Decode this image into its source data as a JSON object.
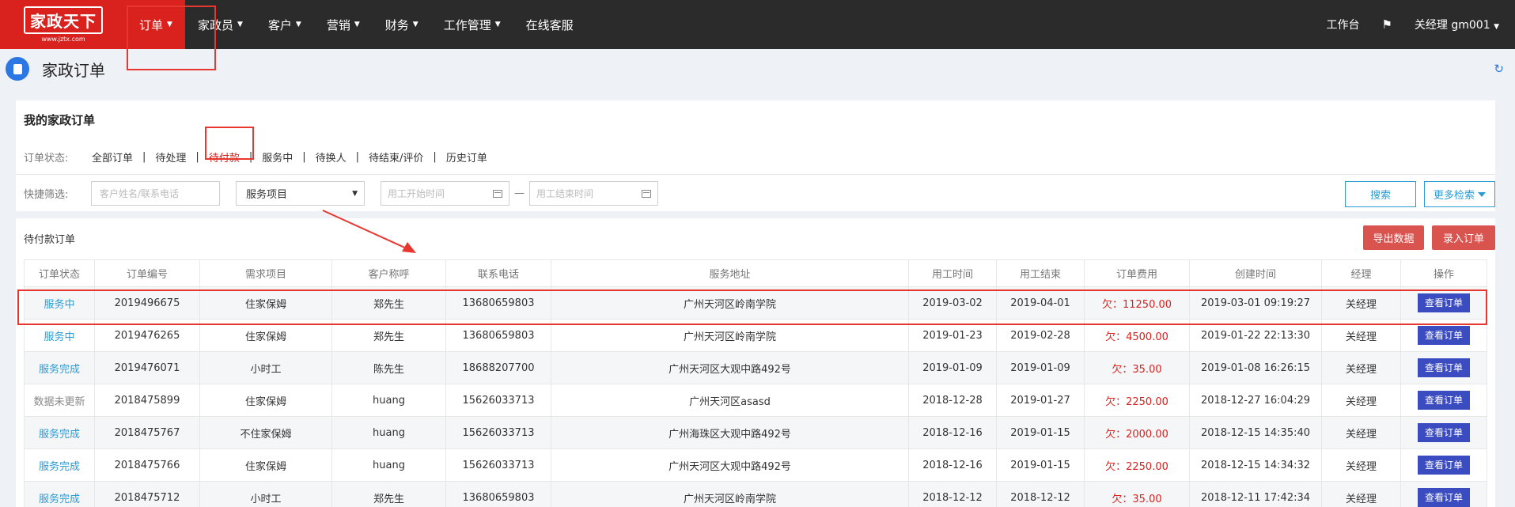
{
  "logo": {
    "main": "家政天下",
    "sub": "www.jztx.com"
  },
  "nav": {
    "items": [
      {
        "label": "订单",
        "active": true
      },
      {
        "label": "家政员",
        "active": false
      },
      {
        "label": "客户",
        "active": false
      },
      {
        "label": "营销",
        "active": false
      },
      {
        "label": "财务",
        "active": false
      },
      {
        "label": "工作管理",
        "active": false
      },
      {
        "label": "在线客服",
        "active": false
      }
    ],
    "workbench": "工作台",
    "user": "关经理 gm001"
  },
  "page": {
    "title": "家政订单"
  },
  "filter": {
    "title": "我的家政订单",
    "status_label": "订单状态:",
    "tabs": [
      "全部订单",
      "待处理",
      "待付款",
      "服务中",
      "待换人",
      "待结束/评价",
      "历史订单"
    ],
    "active_tab": "待付款",
    "quick_label": "快捷筛选:",
    "customer_placeholder": "客户姓名/联系电话",
    "service_select": "服务项目",
    "start_placeholder": "用工开始时间",
    "end_placeholder": "用工结束时间",
    "search_btn": "搜索",
    "more_btn": "更多检索"
  },
  "orders": {
    "title": "待付款订单",
    "export_btn": "导出数据",
    "add_btn": "录入订单",
    "columns": [
      "订单状态",
      "订单编号",
      "需求项目",
      "客户称呼",
      "联系电话",
      "服务地址",
      "用工时间",
      "用工结束",
      "订单费用",
      "创建时间",
      "经理",
      "操作"
    ],
    "view_btn": "查看订单",
    "rows": [
      {
        "status": "服务中",
        "status_type": "blue",
        "id": "2019496675",
        "item": "住家保姆",
        "customer": "郑先生",
        "phone": "13680659803",
        "address": "广州天河区岭南学院",
        "start": "2019-03-02",
        "end": "2019-04-01",
        "fee": "欠：11250.00",
        "created": "2019-03-01 09:19:27",
        "manager": "关经理"
      },
      {
        "status": "服务中",
        "status_type": "blue",
        "id": "2019476265",
        "item": "住家保姆",
        "customer": "郑先生",
        "phone": "13680659803",
        "address": "广州天河区岭南学院",
        "start": "2019-01-23",
        "end": "2019-02-28",
        "fee": "欠：4500.00",
        "created": "2019-01-22 22:13:30",
        "manager": "关经理"
      },
      {
        "status": "服务完成",
        "status_type": "blue",
        "id": "2019476071",
        "item": "小时工",
        "customer": "陈先生",
        "phone": "18688207700",
        "address": "广州天河区大观中路492号",
        "start": "2019-01-09",
        "end": "2019-01-09",
        "fee": "欠：35.00",
        "created": "2019-01-08 16:26:15",
        "manager": "关经理"
      },
      {
        "status": "数据未更新",
        "status_type": "gray",
        "id": "2018475899",
        "item": "住家保姆",
        "customer": "huang",
        "phone": "15626033713",
        "address": "广州天河区asasd",
        "start": "2018-12-28",
        "end": "2019-01-27",
        "fee": "欠：2250.00",
        "created": "2018-12-27 16:04:29",
        "manager": "关经理"
      },
      {
        "status": "服务完成",
        "status_type": "blue",
        "id": "2018475767",
        "item": "不住家保姆",
        "customer": "huang",
        "phone": "15626033713",
        "address": "广州海珠区大观中路492号",
        "start": "2018-12-16",
        "end": "2019-01-15",
        "fee": "欠：2000.00",
        "created": "2018-12-15 14:35:40",
        "manager": "关经理"
      },
      {
        "status": "服务完成",
        "status_type": "blue",
        "id": "2018475766",
        "item": "住家保姆",
        "customer": "huang",
        "phone": "15626033713",
        "address": "广州天河区大观中路492号",
        "start": "2018-12-16",
        "end": "2019-01-15",
        "fee": "欠：2250.00",
        "created": "2018-12-15 14:34:32",
        "manager": "关经理"
      },
      {
        "status": "服务完成",
        "status_type": "blue",
        "id": "2018475712",
        "item": "小时工",
        "customer": "郑先生",
        "phone": "13680659803",
        "address": "广州天河区岭南学院",
        "start": "2018-12-12",
        "end": "2018-12-12",
        "fee": "欠：35.00",
        "created": "2018-12-11 17:42:34",
        "manager": "关经理"
      }
    ]
  },
  "colors": {
    "brand_red": "#d9211e",
    "nav_bg": "#2b2b2b",
    "link_blue": "#2b9bd4",
    "view_btn": "#3b4cc0"
  }
}
